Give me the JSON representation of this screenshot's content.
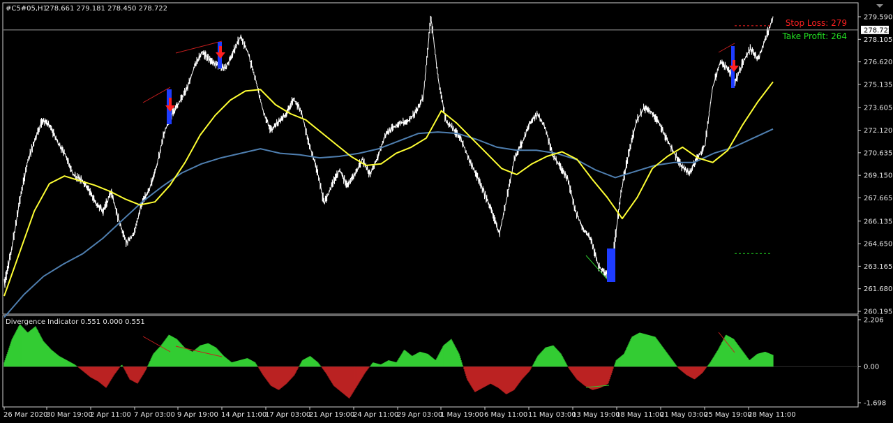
{
  "header": {
    "symbol": "#C5#05,H1",
    "ohlc": "278.661 279.181 278.450 278.722"
  },
  "indicator_header": "Divergence Indicator 0.551 0.000 0.551",
  "stop_loss_label": "Stop Loss: 279",
  "take_profit_label": "Take Profit: 264",
  "current_price_label": "278.722",
  "colors": {
    "background": "#000000",
    "price": "#ffffff",
    "ma_fast": "#ffff33",
    "ma_slow": "#4f7fb0",
    "osc_pos": "#33cc33",
    "osc_neg": "#bb2222",
    "stop_loss": "#ff2020",
    "take_profit": "#22dd22",
    "sell_arrow": "#ff2020",
    "signal_bar": "#1e3cff"
  },
  "chart_data": [
    {
      "type": "line",
      "title": "",
      "y_ticks": [
        "279.590",
        "278.105",
        "276.620",
        "275.135",
        "273.605",
        "272.120",
        "270.635",
        "269.150",
        "267.665",
        "266.135",
        "264.650",
        "263.165",
        "261.680",
        "260.195"
      ],
      "ylim": [
        260.195,
        279.59
      ],
      "x_ticks": [
        "26 Mar 2020",
        "30 Mar 19:00",
        "2 Apr 11:00",
        "7 Apr 03:00",
        "9 Apr 19:00",
        "14 Apr 11:00",
        "17 Apr 03:00",
        "21 Apr 19:00",
        "24 Apr 11:00",
        "29 Apr 03:00",
        "1 May 19:00",
        "6 May 11:00",
        "11 May 03:00",
        "13 May 19:00",
        "18 May 11:00",
        "21 May 03:00",
        "25 May 19:00",
        "28 May 11:00"
      ],
      "current_price": 278.722,
      "stop_loss": 279,
      "take_profit": 264,
      "series": [
        {
          "key": "price",
          "values": [
            262.0,
            264.5,
            267.5,
            270.0,
            271.5,
            272.8,
            272.4,
            271.3,
            270.5,
            269.2,
            268.9,
            268.3,
            267.3,
            266.8,
            268.1,
            266.2,
            264.7,
            265.3,
            267.3,
            268.2,
            269.8,
            272.0,
            273.2,
            274.0,
            274.9,
            276.4,
            277.3,
            276.7,
            276.4,
            276.2,
            277.2,
            278.3,
            277.2,
            275.4,
            273.3,
            272.1,
            272.7,
            273.2,
            274.2,
            273.3,
            271.2,
            269.6,
            267.3,
            268.5,
            269.5,
            268.5,
            269.2,
            270.2,
            269.2,
            270.3,
            271.8,
            272.3,
            272.6,
            272.7,
            273.3,
            274.3,
            279.6,
            275.4,
            272.7,
            272.2,
            271.5,
            270.2,
            269.2,
            268.0,
            266.8,
            265.3,
            267.7,
            270.3,
            271.3,
            272.6,
            273.2,
            272.3,
            270.5,
            269.7,
            268.9,
            266.8,
            265.6,
            265.0,
            263.2,
            262.6,
            264.1,
            268.1,
            270.6,
            272.7,
            273.6,
            273.3,
            272.6,
            271.5,
            270.6,
            269.7,
            269.3,
            270.3,
            271.1,
            274.9,
            276.6,
            276.2,
            275.3,
            276.6,
            277.5,
            276.8,
            278.2,
            279.6
          ]
        },
        {
          "key": "ma_fast",
          "values": [
            261.2,
            264.0,
            266.8,
            268.6,
            269.1,
            268.8,
            268.5,
            268.1,
            267.6,
            267.2,
            267.4,
            268.5,
            270.0,
            271.8,
            273.1,
            274.1,
            274.7,
            274.8,
            273.8,
            273.2,
            272.8,
            272.0,
            271.2,
            270.4,
            269.8,
            269.9,
            270.6,
            271.0,
            271.6,
            273.4,
            272.6,
            271.6,
            270.6,
            269.6,
            269.2,
            269.9,
            270.4,
            270.7,
            270.2,
            268.9,
            267.7,
            266.3,
            267.7,
            269.6,
            270.4,
            271.0,
            270.3,
            270.0,
            270.8,
            272.5,
            274.0,
            275.3
          ]
        },
        {
          "key": "ma_slow",
          "values": [
            259.8,
            261.3,
            262.5,
            263.3,
            264.0,
            265.0,
            266.2,
            267.4,
            268.4,
            269.3,
            269.9,
            270.3,
            270.6,
            270.9,
            270.6,
            270.5,
            270.3,
            270.4,
            270.6,
            270.9,
            271.4,
            271.9,
            272.0,
            271.9,
            271.5,
            271.0,
            270.8,
            270.8,
            270.6,
            270.2,
            269.5,
            269.0,
            269.4,
            269.8,
            270.0,
            270.0,
            270.6,
            271.0,
            271.6,
            272.2
          ]
        }
      ]
    },
    {
      "type": "area",
      "title": "Divergence Indicator",
      "y_ticks": [
        "2.206",
        "0.00",
        "-1.698"
      ],
      "ylim": [
        -1.698,
        2.206
      ],
      "values": [
        0.2,
        1.3,
        2.0,
        1.6,
        1.9,
        1.2,
        0.8,
        0.5,
        0.3,
        0.1,
        -0.2,
        -0.5,
        -0.7,
        -1.0,
        -0.4,
        0.1,
        -0.6,
        -0.8,
        -0.2,
        0.6,
        1.0,
        1.5,
        1.3,
        0.9,
        0.7,
        1.0,
        1.1,
        0.9,
        0.5,
        0.2,
        0.3,
        0.4,
        0.2,
        -0.4,
        -0.9,
        -1.1,
        -0.8,
        -0.4,
        0.3,
        0.5,
        0.2,
        -0.3,
        -0.9,
        -1.2,
        -1.5,
        -0.9,
        -0.3,
        0.2,
        0.1,
        0.3,
        0.2,
        0.8,
        0.5,
        0.7,
        0.6,
        0.3,
        1.0,
        1.3,
        0.6,
        -0.6,
        -1.2,
        -1.0,
        -0.8,
        -1.0,
        -1.3,
        -1.1,
        -0.6,
        -0.2,
        0.5,
        0.9,
        1.0,
        0.6,
        -0.1,
        -0.6,
        -0.9,
        -1.1,
        -1.0,
        -0.8,
        0.3,
        0.6,
        1.4,
        1.6,
        1.5,
        1.4,
        0.9,
        0.4,
        -0.1,
        -0.4,
        -0.6,
        -0.3,
        0.2,
        0.8,
        1.5,
        1.3,
        0.8,
        0.3,
        0.6,
        0.7,
        0.55
      ]
    }
  ]
}
